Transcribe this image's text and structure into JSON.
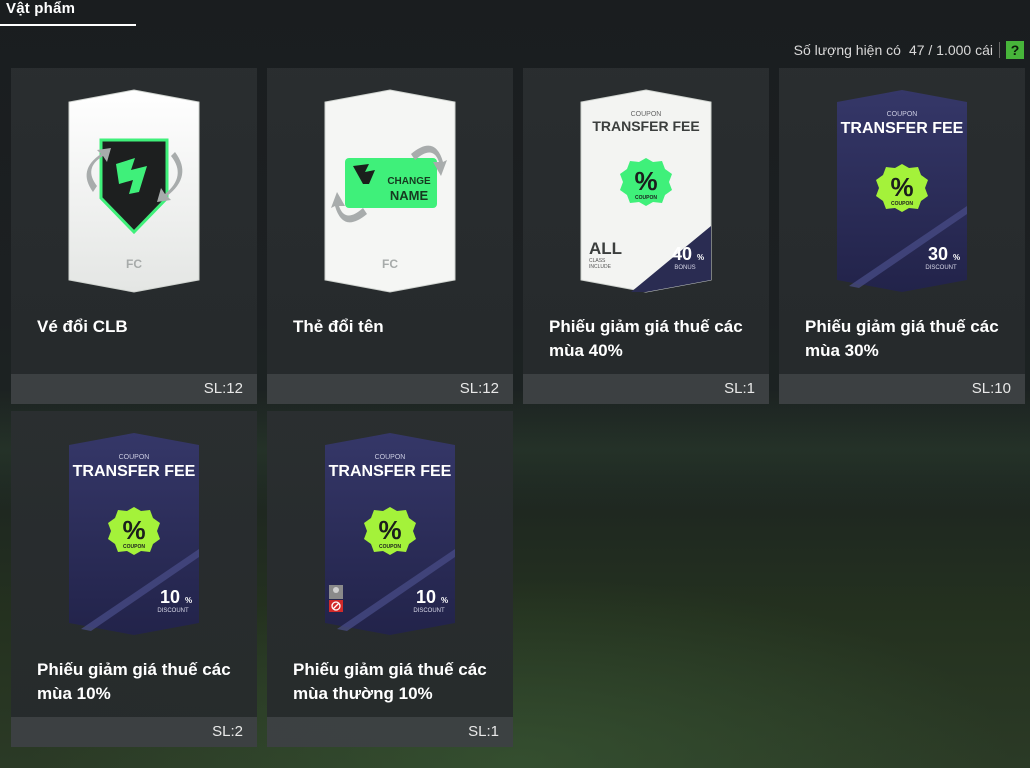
{
  "tab": {
    "label": "Vật phẩm"
  },
  "inventory": {
    "label": "Số lượng hiện có",
    "value": "47 / 1.000 cái",
    "help": "?"
  },
  "colors": {
    "accent_green": "#47b43a",
    "neon_green": "#3ff07a",
    "coupon_green": "#a4f23a",
    "card_purple": "#2b2c58"
  },
  "items": [
    {
      "name": "Vé đổi CLB",
      "qty": "SL:12",
      "icon": "club-change-ticket-icon"
    },
    {
      "name": "Thẻ đổi tên",
      "qty": "SL:12",
      "icon": "change-name-card-icon",
      "card_text": {
        "line1": "CHANGE",
        "line2": "NAME"
      }
    },
    {
      "name": "Phiếu giảm giá thuế các mùa 40%",
      "qty": "SL:1",
      "icon": "transfer-fee-coupon-icon",
      "card_text": {
        "coupon": "COUPON",
        "title": "TRANSFER FEE",
        "badge": "COUPON",
        "percent": "40",
        "unit": "%",
        "sub": "BONUS",
        "all": "ALL",
        "class": "CLASS",
        "include": "INCLUDE"
      }
    },
    {
      "name": "Phiếu giảm giá thuế các mùa 30%",
      "qty": "SL:10",
      "icon": "transfer-fee-coupon-icon",
      "card_text": {
        "coupon": "COUPON",
        "title": "TRANSFER FEE",
        "badge": "COUPON",
        "percent": "30",
        "unit": "%",
        "sub": "DISCOUNT"
      }
    },
    {
      "name": "Phiếu giảm giá thuế các mùa 10%",
      "qty": "SL:2",
      "icon": "transfer-fee-coupon-icon",
      "card_text": {
        "coupon": "COUPON",
        "title": "TRANSFER FEE",
        "badge": "COUPON",
        "percent": "10",
        "unit": "%",
        "sub": "DISCOUNT"
      }
    },
    {
      "name": "Phiếu giảm giá thuế các mùa thường 10%",
      "qty": "SL:1",
      "icon": "transfer-fee-coupon-icon",
      "card_text": {
        "coupon": "COUPON",
        "title": "TRANSFER FEE",
        "badge": "COUPON",
        "percent": "10",
        "unit": "%",
        "sub": "DISCOUNT"
      }
    }
  ]
}
